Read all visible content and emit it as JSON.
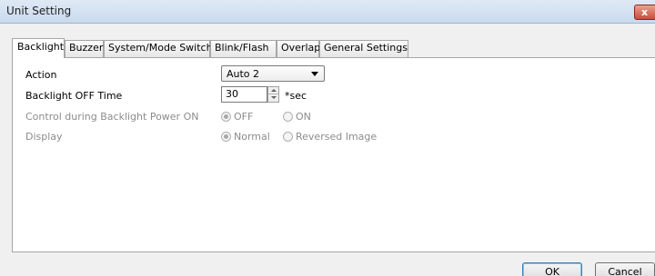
{
  "window": {
    "title": "Unit Setting",
    "close_label": "x"
  },
  "tabs": [
    {
      "label": "Backlight",
      "active": true
    },
    {
      "label": "Buzzer",
      "active": false
    },
    {
      "label": "System/Mode Switch",
      "active": false
    },
    {
      "label": "Blink/Flash",
      "active": false
    },
    {
      "label": "Overlap",
      "active": false
    },
    {
      "label": "General Settings",
      "active": false
    }
  ],
  "backlight": {
    "action_label": "Action",
    "action_value": "Auto 2",
    "off_time_label": "Backlight OFF Time",
    "off_time_value": "30",
    "off_time_unit": "*sec",
    "control_label": "Control during Backlight Power ON",
    "control_options": [
      {
        "label": "OFF",
        "checked": true
      },
      {
        "label": "ON",
        "checked": false
      }
    ],
    "display_label": "Display",
    "display_options": [
      {
        "label": "Normal",
        "checked": true
      },
      {
        "label": "Reversed Image",
        "checked": false
      }
    ]
  },
  "buttons": {
    "ok": "OK",
    "cancel": "Cancel"
  },
  "colors": {
    "titlebar": "#c9daee",
    "dialog_bg": "#f0f0f0",
    "disabled_text": "#8c8c8c",
    "close_button": "#c84d3a"
  }
}
